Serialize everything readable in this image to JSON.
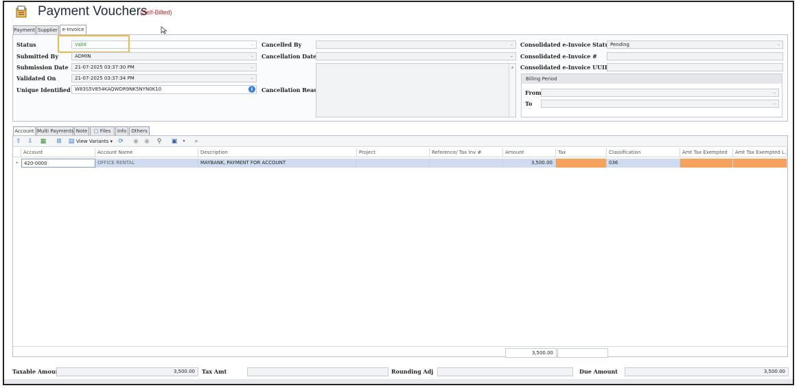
{
  "window": {
    "title": "Payment Vouchers",
    "subtitle": "(Self-Billed)"
  },
  "top_tabs": [
    "Payment",
    "Supplier",
    "e-Invoice"
  ],
  "einvoice": {
    "status_label": "Status",
    "status_value": "Valid",
    "submitted_by_label": "Submitted By",
    "submitted_by_value": "ADMIN",
    "submission_date_label": "Submission Date",
    "submission_date_value": "21-07-2025 03:37:30 PM",
    "validated_on_label": "Validated On",
    "validated_on_value": "21-07-2025 03:37:34 PM",
    "uin_label": "Unique Identified No.",
    "uin_value": "W83S5V854KAQWDR9NK5NYN0K10",
    "cancelled_by_label": "Cancelled By",
    "cancelled_by_value": "",
    "cancellation_date_label": "Cancellation Date",
    "cancellation_date_value": "",
    "cancellation_reason_label": "Cancellation Reason",
    "cancellation_reason_value": "",
    "consolidated_status_label": "Consolidated e-Invoice Status",
    "consolidated_status_value": "Pending",
    "consolidated_no_label": "Consolidated e-Invoice #",
    "consolidated_no_value": "",
    "consolidated_uuid_label": "Consolidated e-Invoice UUID No.",
    "consolidated_uuid_value": "",
    "billing_period_label": "Billing Period",
    "from_label": "From",
    "from_value": "",
    "to_label": "To",
    "to_value": ""
  },
  "bottom_tabs": [
    "Account",
    "Multi Payments",
    "Note",
    "Files",
    "Info",
    "Others"
  ],
  "toolbar": {
    "view_variants_label": "View Variants"
  },
  "table": {
    "columns": [
      "Account",
      "Account Name",
      "Description",
      "Project",
      "Reference/ Tax Inv #",
      "Amount",
      "Tax",
      "Classification",
      "Amt Tax Exempted",
      "Amt Tax Exempted L..."
    ],
    "rows": [
      {
        "account": "420-0000",
        "account_name": "OFFICE RENTAL",
        "description": "MAYBANK, PAYMENT FOR ACCOUNT",
        "project": "",
        "reference": "",
        "amount": "3,500.00",
        "tax": "",
        "classification": "036",
        "amt_tax_exempted": "",
        "amt_tax_exempted_l": ""
      }
    ],
    "footer_amount": "3,500.00",
    "footer_tax": ""
  },
  "summary": {
    "taxable_amount_label": "Taxable Amount",
    "taxable_amount_value": "3,500.00",
    "tax_amt_label": "Tax Amt",
    "tax_amt_value": "",
    "rounding_adj_label": "Rounding Adj",
    "rounding_adj_value": "",
    "due_amount_label": "Due Amount",
    "due_amount_value": "3,500.00"
  },
  "colors": {
    "accent_highlight": "#f0b74a",
    "valid_text": "#2c9a2c",
    "subtitle_red": "#d0282a",
    "row_selected": "#cfdcf0",
    "tax_cell": "#f5a25e"
  }
}
